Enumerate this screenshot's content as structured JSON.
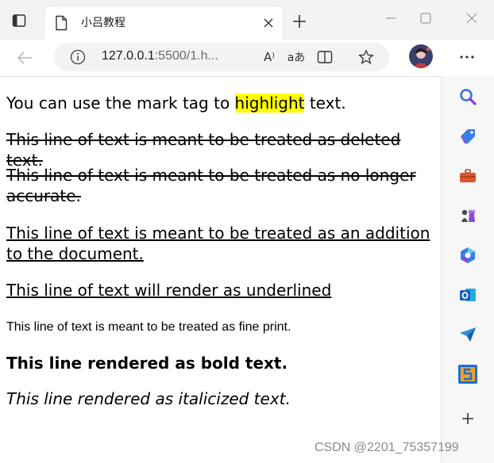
{
  "browser": {
    "tab_title": "小吕教程",
    "url_host": "127.0.0.1",
    "url_rest": ":5500/1.h...",
    "read_aloud_label": "A⁾",
    "translate_label": "aあ"
  },
  "content": {
    "line1_before": "You can use the mark tag to ",
    "line1_mark": "highlight",
    "line1_after": " text.",
    "line2": "This line of text is meant to be treated as deleted text.",
    "line3": "This line of text is meant to be treated as no longer accurate.",
    "line4": "This line of text is meant to be treated as an addition to the document.",
    "line5": "This line of text will render as underlined",
    "line6": "This line of text is meant to be treated as fine print.",
    "line7": "This line rendered as bold text.",
    "line8": "This line rendered as italicized text."
  },
  "watermark": "CSDN @2201_75357199",
  "colors": {
    "highlight": "#ffff00",
    "titlebar": "#f3f3f3",
    "address_bg": "#f1f3f4"
  },
  "icons": [
    "sidebar-toggle-icon",
    "document-icon",
    "close-icon",
    "plus-icon",
    "minimize-icon",
    "maximize-icon",
    "window-close-icon",
    "back-arrow-icon",
    "info-icon",
    "read-aloud-icon",
    "translate-icon",
    "split-screen-icon",
    "favorites-star-icon",
    "more-icon",
    "search-icon",
    "tag-icon",
    "briefcase-icon",
    "chess-icon",
    "copilot-icon",
    "outlook-icon",
    "send-icon",
    "app-s-icon",
    "add-icon"
  ]
}
